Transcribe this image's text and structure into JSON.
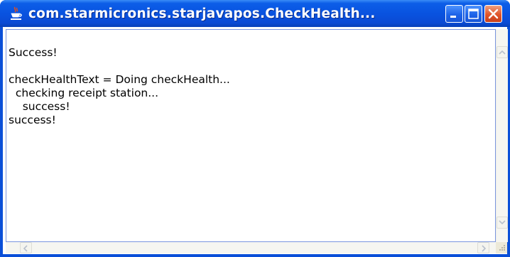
{
  "window": {
    "title": "com.starmicronics.starjavapos.CheckHealth...",
    "icon": "java-coffee-cup-icon"
  },
  "titlebar_buttons": {
    "minimize": "minimize-icon",
    "maximize": "maximize-icon",
    "close": "close-icon"
  },
  "console": {
    "lines": [
      "Success!",
      "",
      "checkHealthText = Doing checkHealth...",
      "  checking receipt station...",
      "    success!",
      "success!"
    ]
  },
  "colors": {
    "titlebar": "#0a4ad4",
    "close_button": "#e0542a",
    "text": "#000000"
  }
}
